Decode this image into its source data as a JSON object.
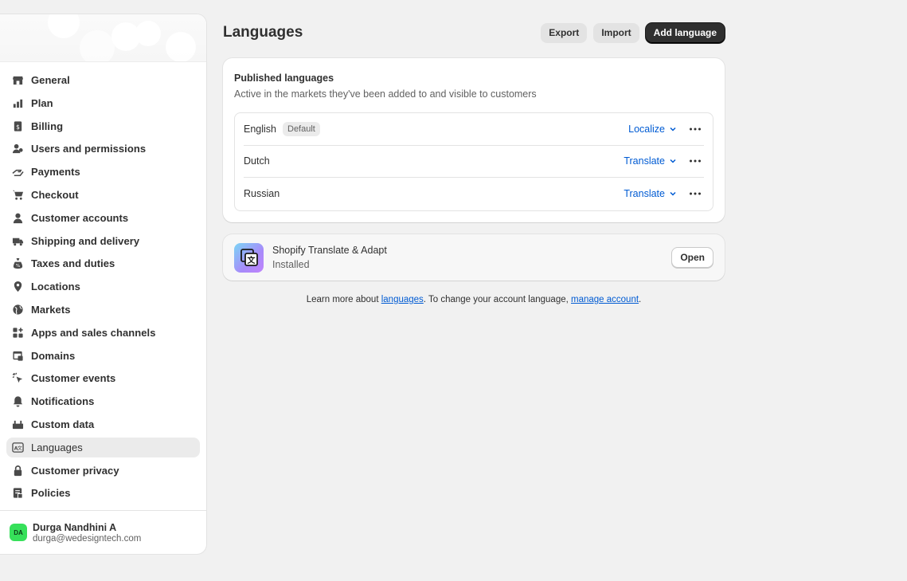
{
  "sidebar": {
    "items": [
      {
        "label": "General",
        "icon": "store-icon"
      },
      {
        "label": "Plan",
        "icon": "plan-icon"
      },
      {
        "label": "Billing",
        "icon": "billing-icon"
      },
      {
        "label": "Users and permissions",
        "icon": "users-icon"
      },
      {
        "label": "Payments",
        "icon": "payments-icon"
      },
      {
        "label": "Checkout",
        "icon": "cart-icon"
      },
      {
        "label": "Customer accounts",
        "icon": "person-icon"
      },
      {
        "label": "Shipping and delivery",
        "icon": "truck-icon"
      },
      {
        "label": "Taxes and duties",
        "icon": "tax-icon"
      },
      {
        "label": "Locations",
        "icon": "location-icon"
      },
      {
        "label": "Markets",
        "icon": "globe-icon"
      },
      {
        "label": "Apps and sales channels",
        "icon": "apps-icon"
      },
      {
        "label": "Domains",
        "icon": "domain-icon"
      },
      {
        "label": "Customer events",
        "icon": "cursor-icon"
      },
      {
        "label": "Notifications",
        "icon": "bell-icon"
      },
      {
        "label": "Custom data",
        "icon": "database-icon"
      },
      {
        "label": "Languages",
        "icon": "language-icon",
        "active": true
      },
      {
        "label": "Customer privacy",
        "icon": "lock-icon"
      },
      {
        "label": "Policies",
        "icon": "policy-icon"
      }
    ],
    "user": {
      "initials": "DA",
      "name": "Durga Nandhini A",
      "email": "durga@wedesigntech.com",
      "avatar_color": "#36e05a"
    }
  },
  "header": {
    "title": "Languages",
    "export_label": "Export",
    "import_label": "Import",
    "add_label": "Add language"
  },
  "published": {
    "title": "Published languages",
    "subtitle": "Active in the markets they've been added to and visible to customers",
    "languages": [
      {
        "name": "English",
        "badge": "Default",
        "action": "Localize"
      },
      {
        "name": "Dutch",
        "badge": "",
        "action": "Translate"
      },
      {
        "name": "Russian",
        "badge": "",
        "action": "Translate"
      }
    ]
  },
  "app": {
    "name": "Shopify Translate & Adapt",
    "status": "Installed",
    "open_label": "Open"
  },
  "footer": {
    "prefix": "Learn more about ",
    "link1": "languages",
    "middle": ". To change your account language, ",
    "link2": "manage account",
    "suffix": "."
  },
  "colors": {
    "link": "#005bd3",
    "primary_button": "#303030",
    "background": "#f1f1f1"
  }
}
